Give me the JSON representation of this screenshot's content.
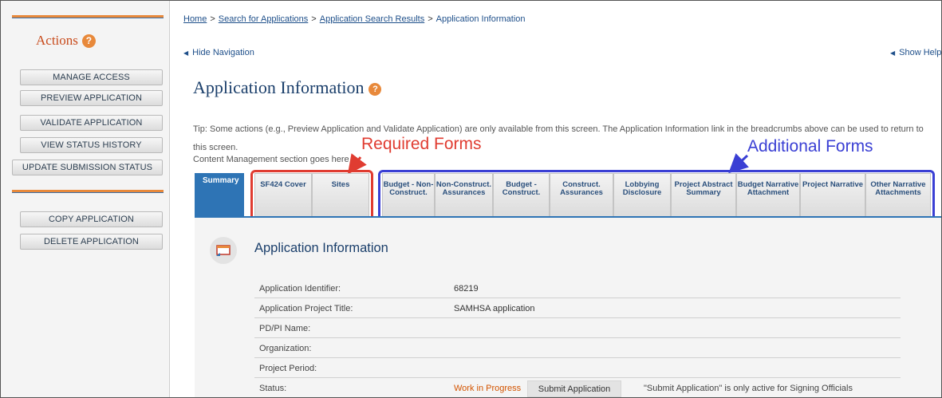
{
  "sidebar": {
    "actions_title": "Actions",
    "buttons": [
      "MANAGE ACCESS",
      "PREVIEW APPLICATION",
      "VALIDATE APPLICATION",
      "VIEW STATUS HISTORY",
      "UPDATE SUBMISSION STATUS"
    ],
    "buttons2": [
      "COPY APPLICATION",
      "DELETE APPLICATION"
    ]
  },
  "breadcrumb": {
    "home": "Home",
    "search": "Search for Applications",
    "results": "Application Search Results",
    "current": "Application Information",
    "sep": ">"
  },
  "nav": {
    "hide": "Hide Navigation",
    "show_help": "Show Help"
  },
  "page": {
    "title": "Application Information",
    "tip": "Tip: Some actions (e.g., Preview Application and Validate Application) are only available from this screen. The Application Information link in the breadcrumbs above can be used to return to this screen.",
    "cms": "Content Management section goes here"
  },
  "annotations": {
    "required": "Required Forms",
    "additional": "Additional Forms"
  },
  "tabs": [
    "Summary",
    "SF424 Cover",
    "Sites",
    "Budget - Non-Construct.",
    "Non-Construct. Assurances",
    "Budget - Construct.",
    "Construct. Assurances",
    "Lobbying Disclosure",
    "Project Abstract Summary",
    "Budget Narrative Attachment",
    "Project Narrative",
    "Other Narrative Attachments"
  ],
  "section": {
    "title": "Application Information",
    "rows": [
      {
        "label": "Application Identifier:",
        "value": "68219"
      },
      {
        "label": "Application Project Title:",
        "value": "SAMHSA application"
      },
      {
        "label": "PD/PI Name:",
        "value": ""
      },
      {
        "label": "Organization:",
        "value": ""
      },
      {
        "label": "Project Period:",
        "value": ""
      }
    ],
    "status": {
      "label": "Status:",
      "value": "Work in Progress",
      "submit_button": "Submit Application",
      "note": "\"Submit Application\" is only active for Signing Officials"
    }
  },
  "colors": {
    "accent_orange": "#e8893b",
    "annotation_red": "#e03c31",
    "annotation_blue": "#3a3fd4",
    "tab_active": "#2e74b5",
    "title_blue": "#1b3f6b"
  }
}
